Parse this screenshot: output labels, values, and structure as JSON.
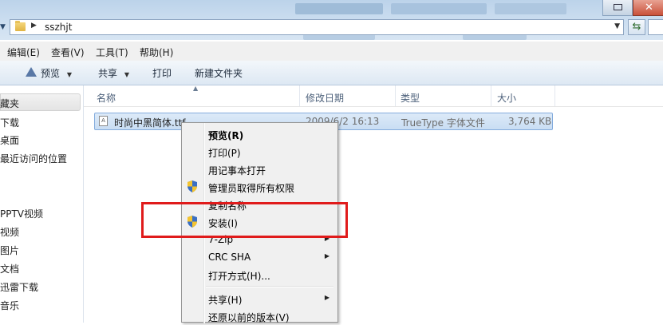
{
  "address": {
    "path": "sszhjt"
  },
  "menubar": [
    {
      "label": "编辑(E)"
    },
    {
      "label": "查看(V)"
    },
    {
      "label": "工具(T)"
    },
    {
      "label": "帮助(H)"
    }
  ],
  "toolbar": {
    "preview": "预览",
    "share": "共享",
    "print": "打印",
    "new_folder": "新建文件夹"
  },
  "navpane": {
    "items": [
      {
        "label": "藏夹"
      },
      {
        "label": "下载"
      },
      {
        "label": "桌面"
      },
      {
        "label": "最近访问的位置"
      },
      {
        "label": "PPTV视频"
      },
      {
        "label": "视频"
      },
      {
        "label": "图片"
      },
      {
        "label": "文档"
      },
      {
        "label": "迅雷下载"
      },
      {
        "label": "音乐"
      }
    ]
  },
  "columns": {
    "name": "名称",
    "modified": "修改日期",
    "type": "类型",
    "size": "大小"
  },
  "file": {
    "name": "时尚中黑简体.ttf",
    "modified": "2009/6/2 16:13",
    "type": "TrueType 字体文件",
    "size": "3,764 KB"
  },
  "context_menu": {
    "items": [
      {
        "label": "预览(R)"
      },
      {
        "label": "打印(P)"
      },
      {
        "label": "用记事本打开"
      },
      {
        "label": "管理员取得所有权限"
      },
      {
        "label": "复制名称"
      },
      {
        "label": "安装(I)"
      },
      {
        "label": "7-Zip"
      },
      {
        "label": "CRC SHA"
      },
      {
        "label": "打开方式(H)..."
      },
      {
        "label": "共享(H)"
      },
      {
        "label": "还原以前的版本(V)"
      }
    ]
  },
  "colors": {
    "highlight_box": "#e01b1b",
    "selection": "#cfe1f5"
  }
}
